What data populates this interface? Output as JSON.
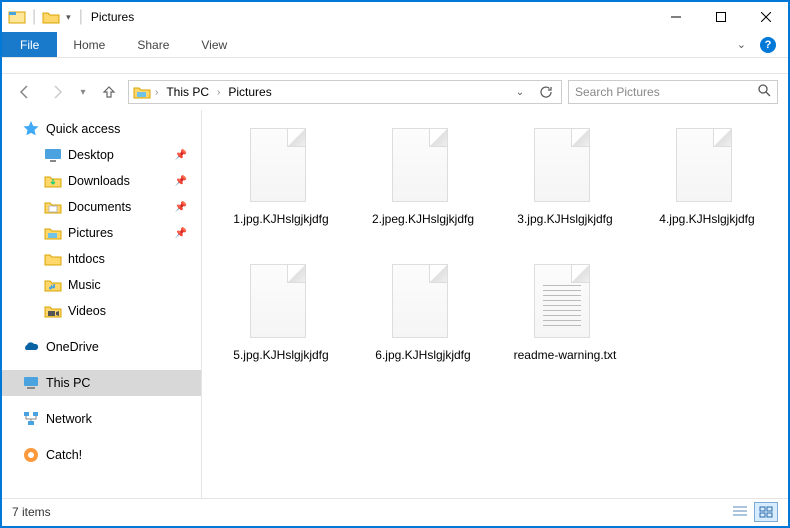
{
  "window": {
    "title": "Pictures"
  },
  "ribbon": {
    "file": "File",
    "tabs": [
      "Home",
      "Share",
      "View"
    ]
  },
  "breadcrumb": {
    "items": [
      "This PC",
      "Pictures"
    ]
  },
  "search": {
    "placeholder": "Search Pictures"
  },
  "sidebar": {
    "quick_access": {
      "label": "Quick access",
      "items": [
        {
          "label": "Desktop",
          "icon": "desktop",
          "pinned": true
        },
        {
          "label": "Downloads",
          "icon": "downloads",
          "pinned": true
        },
        {
          "label": "Documents",
          "icon": "documents",
          "pinned": true
        },
        {
          "label": "Pictures",
          "icon": "pictures",
          "pinned": true
        },
        {
          "label": "htdocs",
          "icon": "folder",
          "pinned": false
        },
        {
          "label": "Music",
          "icon": "music",
          "pinned": false
        },
        {
          "label": "Videos",
          "icon": "videos",
          "pinned": false
        }
      ]
    },
    "onedrive": {
      "label": "OneDrive"
    },
    "thispc": {
      "label": "This PC"
    },
    "network": {
      "label": "Network"
    },
    "catch": {
      "label": "Catch!"
    }
  },
  "files": [
    {
      "name": "1.jpg.KJHslgjkjdfg",
      "type": "blank"
    },
    {
      "name": "2.jpeg.KJHslgjkjdfg",
      "type": "blank"
    },
    {
      "name": "3.jpg.KJHslgjkjdfg",
      "type": "blank"
    },
    {
      "name": "4.jpg.KJHslgjkjdfg",
      "type": "blank"
    },
    {
      "name": "5.jpg.KJHslgjkjdfg",
      "type": "blank"
    },
    {
      "name": "6.jpg.KJHslgjkjdfg",
      "type": "blank"
    },
    {
      "name": "readme-warning.txt",
      "type": "txt"
    }
  ],
  "status": {
    "count": "7 items"
  }
}
